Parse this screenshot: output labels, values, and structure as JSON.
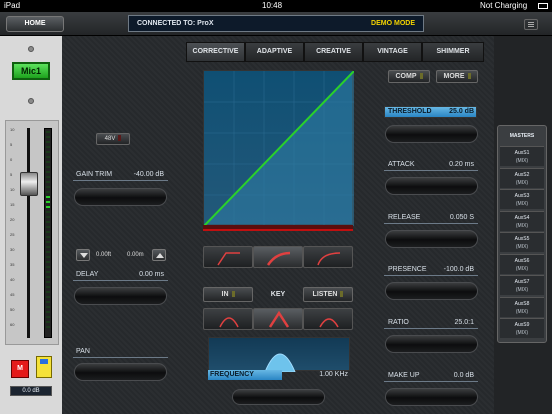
{
  "status_bar": {
    "device": "iPad",
    "time": "10:48",
    "charging": "Not Charging"
  },
  "header": {
    "home_label": "HOME",
    "connected_text": "CONNECTED TO: ProX",
    "mode": "DEMO MODE"
  },
  "channel": {
    "name": "Mic1",
    "mute_label": "M",
    "gain_readout": "0.0 dB",
    "fader_scale": [
      "10",
      "5",
      "0",
      "5",
      "10",
      "15",
      "20",
      "25",
      "30",
      "35",
      "40",
      "45",
      "50",
      "60"
    ]
  },
  "tabs": [
    "CORRECTIVE",
    "ADAPTIVE",
    "CREATIVE",
    "VINTAGE",
    "SHIMMER"
  ],
  "left_controls": {
    "phantom_label": "48V",
    "gain_trim": {
      "label": "GAIN TRIM",
      "value": "-40.00 dB"
    },
    "delay_ft": "0.00ft",
    "delay_m": "0.00m",
    "delay": {
      "label": "DELAY",
      "value": "0.00 ms"
    },
    "pan": {
      "label": "PAN",
      "value": ""
    }
  },
  "center": {
    "in_label": "IN",
    "key_label": "KEY",
    "listen_label": "LISTEN",
    "frequency": {
      "label": "FREQUENCY",
      "value": "1.00 KHz"
    }
  },
  "right_controls": {
    "comp_label": "COMP",
    "more_label": "MORE",
    "threshold": {
      "label": "THRESHOLD",
      "value": "25.0 dB"
    },
    "attack": {
      "label": "ATTACK",
      "value": "0.20 ms"
    },
    "release": {
      "label": "RELEASE",
      "value": "0.050 S"
    },
    "presence": {
      "label": "PRESENCE",
      "value": "-100.0 dB"
    },
    "ratio": {
      "label": "RATIO",
      "value": "25.0:1"
    },
    "makeup": {
      "label": "MAKE UP",
      "value": "0.0 dB"
    }
  },
  "masters": {
    "title": "MASTERS",
    "items": [
      {
        "name": "AuxS1",
        "mode": "(MIX)"
      },
      {
        "name": "AuxS2",
        "mode": "(MIX)"
      },
      {
        "name": "AuxS3",
        "mode": "(MIX)"
      },
      {
        "name": "AuxS4",
        "mode": "(MIX)"
      },
      {
        "name": "AuxS5",
        "mode": "(MIX)"
      },
      {
        "name": "AuxS6",
        "mode": "(MIX)"
      },
      {
        "name": "AuxS7",
        "mode": "(MIX)"
      },
      {
        "name": "AuxS8",
        "mode": "(MIX)"
      },
      {
        "name": "AuxS9",
        "mode": "(MIX)"
      }
    ]
  },
  "colors": {
    "accent": "#2a86c4",
    "curve": "#2ad12a",
    "mode": "#f2d300"
  },
  "icons": [
    "battery-icon",
    "bluetooth-icon",
    "wifi-icon",
    "menu-icon"
  ]
}
